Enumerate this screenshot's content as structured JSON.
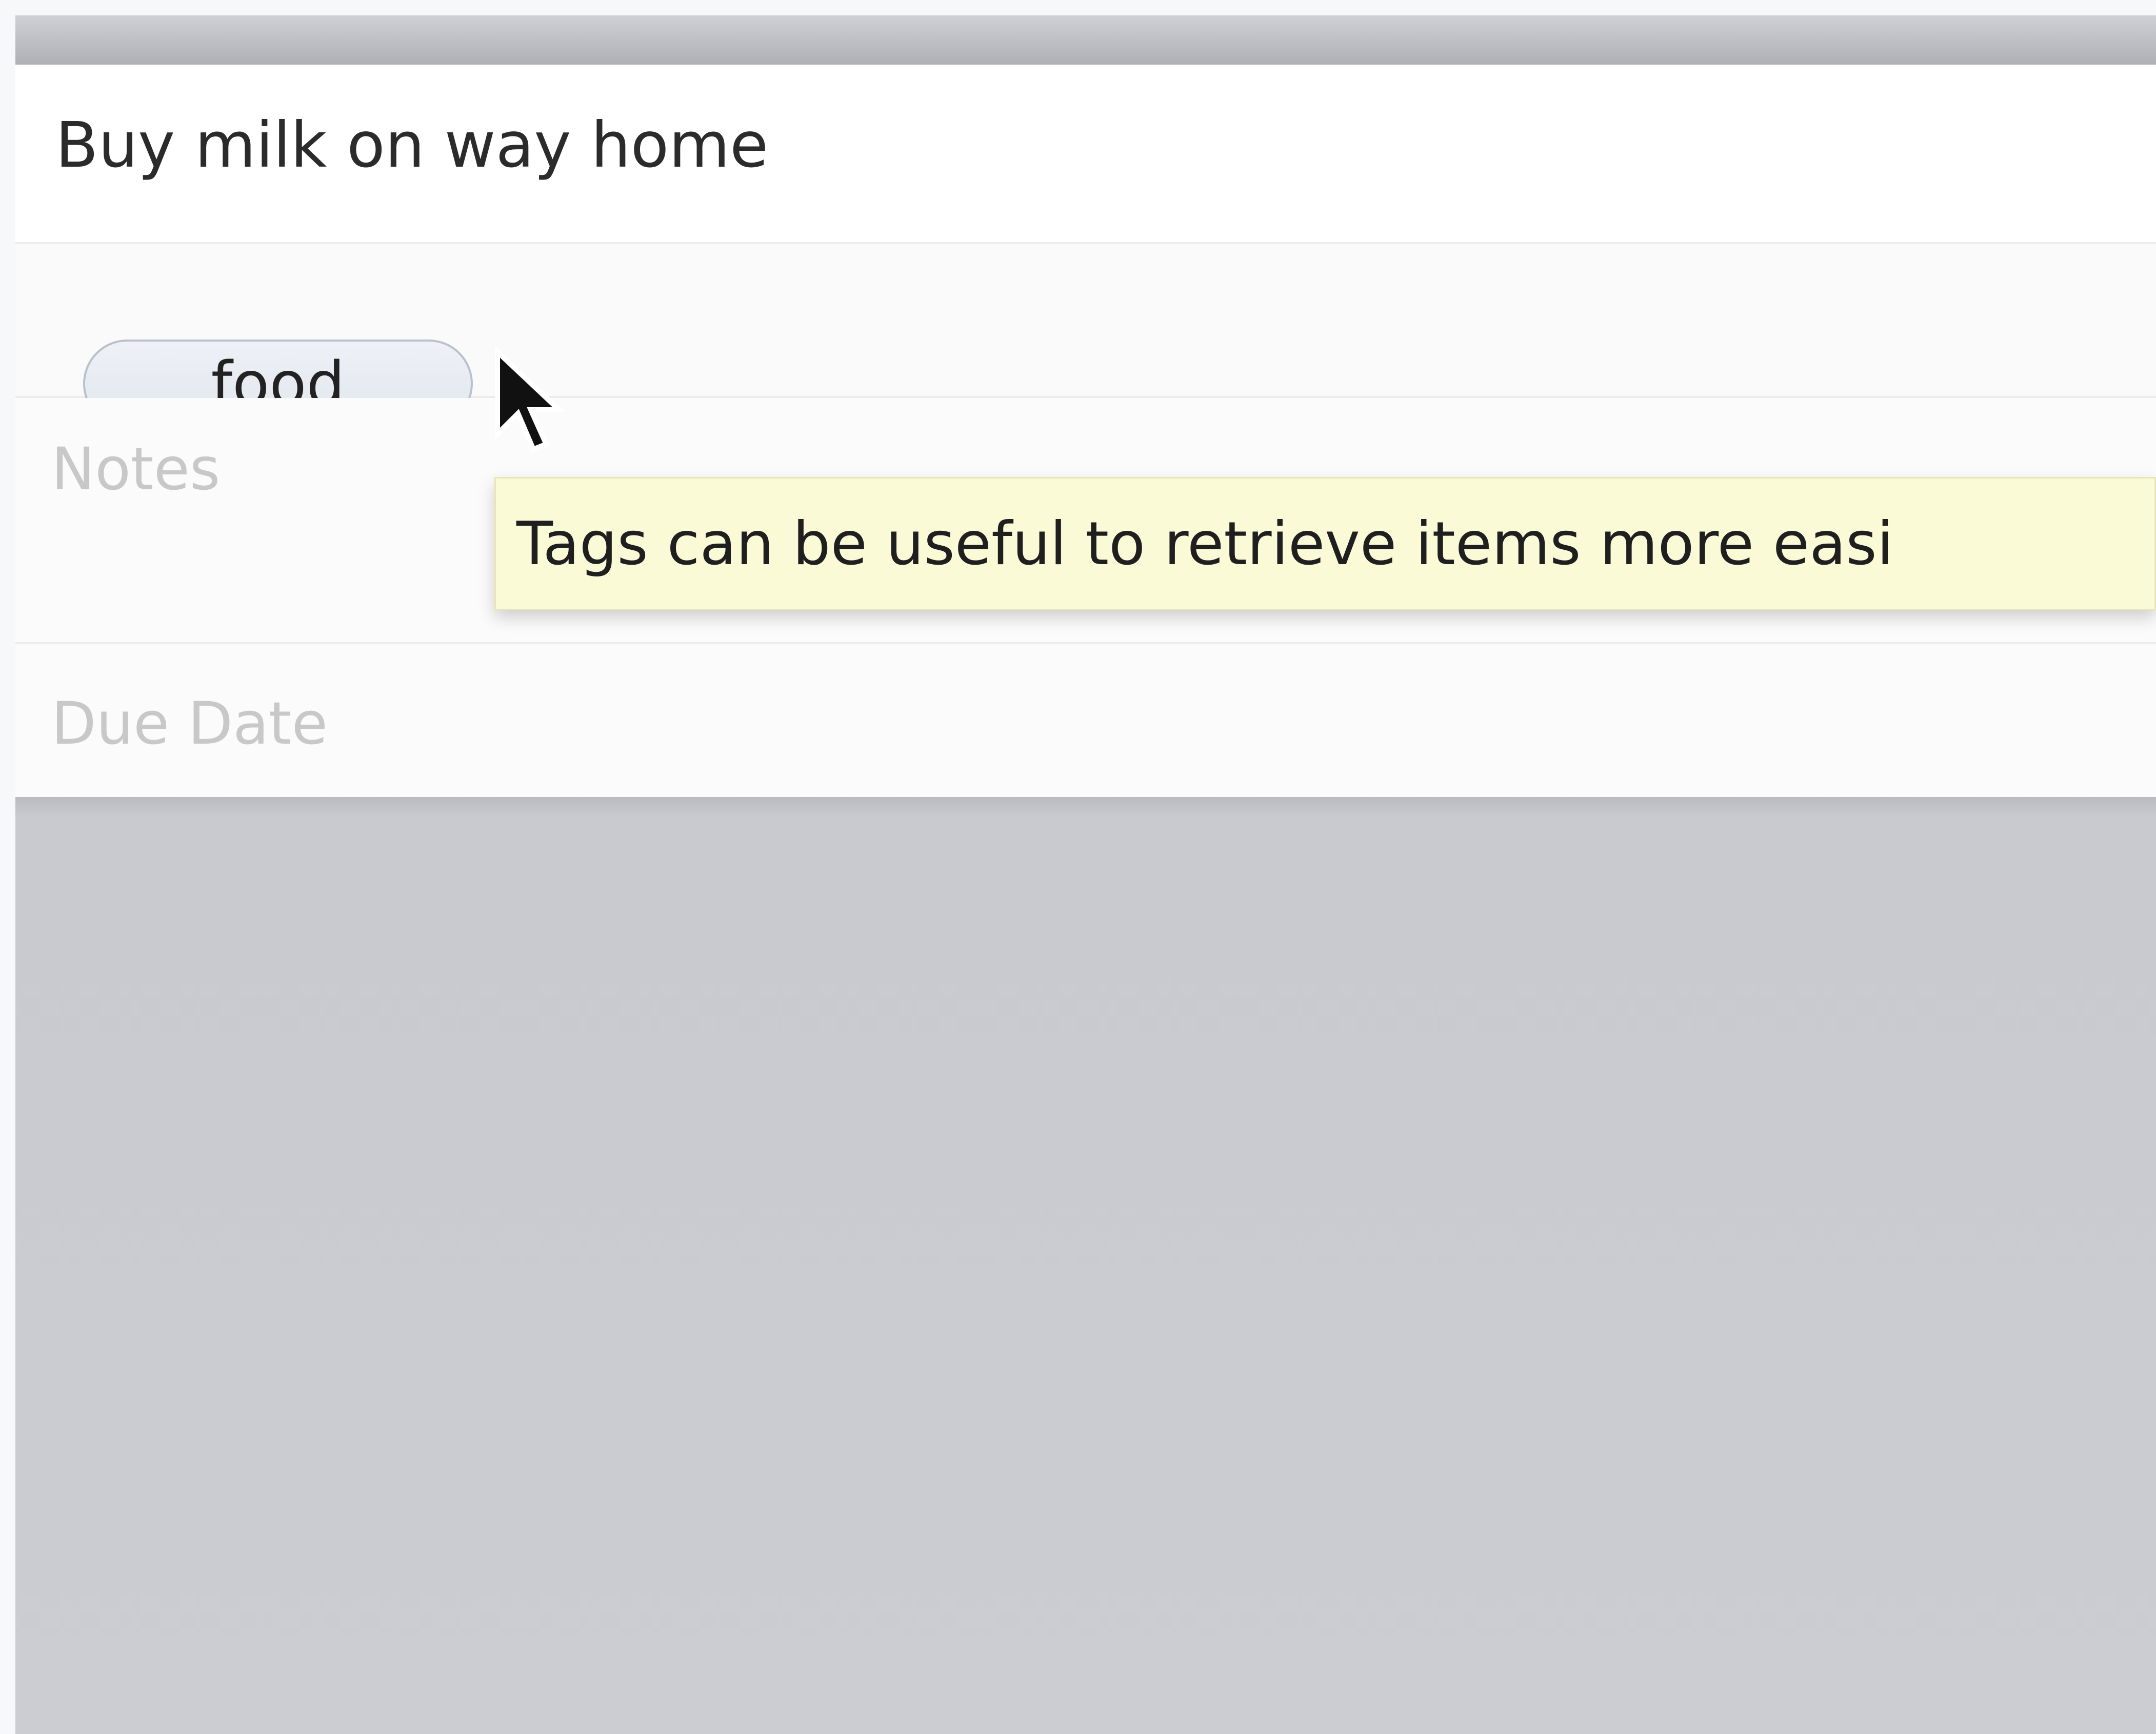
{
  "task": {
    "title": "Buy milk on way home",
    "tag": "food",
    "notes_placeholder": "Notes",
    "due_date_placeholder": "Due Date"
  },
  "tooltip": {
    "text": "Tags can be useful to retrieve items more easi"
  },
  "cursor": {
    "icon": "arrow-cursor-icon"
  },
  "colors": {
    "tooltip_background": "#fbfad6",
    "tag_background": "#e6eaf1",
    "list_background": "#c9cbd1"
  }
}
